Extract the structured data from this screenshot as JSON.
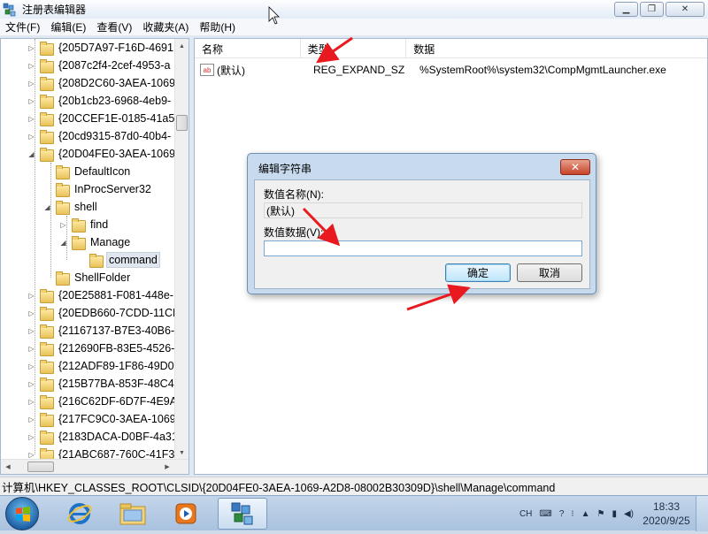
{
  "window": {
    "title": "注册表编辑器",
    "minimize_glyph": "▁",
    "maximize_glyph": "❐",
    "close_glyph": "✕"
  },
  "menu": [
    "文件(F)",
    "编辑(E)",
    "查看(V)",
    "收藏夹(A)",
    "帮助(H)"
  ],
  "tree": [
    {
      "label": "{205D7A97-F16D-4691",
      "expander": "▷"
    },
    {
      "label": "{2087c2f4-2cef-4953-a",
      "expander": "▷"
    },
    {
      "label": "{208D2C60-3AEA-1069",
      "expander": "▷"
    },
    {
      "label": "{20b1cb23-6968-4eb9-",
      "expander": "▷"
    },
    {
      "label": "{20CCEF1E-0185-41a5-",
      "expander": "▷"
    },
    {
      "label": "{20cd9315-87d0-40b4-",
      "expander": "▷"
    },
    {
      "label": "{20D04FE0-3AEA-1069-",
      "expander": "◢"
    },
    {
      "label": "DefaultIcon",
      "expander": ""
    },
    {
      "label": "InProcServer32",
      "expander": ""
    },
    {
      "label": "shell",
      "expander": "◢"
    },
    {
      "label": "find",
      "expander": "▷"
    },
    {
      "label": "Manage",
      "expander": "◢"
    },
    {
      "label": "command",
      "expander": ""
    },
    {
      "label": "ShellFolder",
      "expander": ""
    },
    {
      "label": "{20E25881-F081-448e-",
      "expander": "▷"
    },
    {
      "label": "{20EDB660-7CDD-11CF",
      "expander": "▷"
    },
    {
      "label": "{21167137-B7E3-40B6-",
      "expander": "▷"
    },
    {
      "label": "{212690FB-83E5-4526-",
      "expander": "▷"
    },
    {
      "label": "{212ADF89-1F86-49D0-",
      "expander": "▷"
    },
    {
      "label": "{215B77BA-853F-48C4-",
      "expander": "▷"
    },
    {
      "label": "{216C62DF-6D7F-4E9A",
      "expander": "▷"
    },
    {
      "label": "{217FC9C0-3AEA-1069-",
      "expander": "▷"
    },
    {
      "label": "{2183DACA-D0BF-4a31",
      "expander": "▷"
    },
    {
      "label": "{21ABC687-760C-41F3-",
      "expander": "▷"
    }
  ],
  "list": {
    "columns": [
      "名称",
      "类型",
      "数据"
    ],
    "row": {
      "icon": "ab",
      "name": "(默认)",
      "type": "REG_EXPAND_SZ",
      "data": "%SystemRoot%\\system32\\CompMgmtLauncher.exe"
    }
  },
  "status": "计算机\\HKEY_CLASSES_ROOT\\CLSID\\{20D04FE0-3AEA-1069-A2D8-08002B30309D}\\shell\\Manage\\command",
  "dialog": {
    "title": "编辑字符串",
    "close_glyph": "✕",
    "name_label": "数值名称(N):",
    "name_value": "(默认)",
    "data_label": "数值数据(V):",
    "data_value": "",
    "ok_label": "确定",
    "cancel_label": "取消"
  },
  "taskbar": {
    "lang": "CH",
    "time": "18:33",
    "date": "2020/9/25"
  },
  "colors": {
    "annotation_arrow": "#e8191f",
    "selection": "#dfe6ef",
    "taskbar": "#b4cbe4"
  }
}
